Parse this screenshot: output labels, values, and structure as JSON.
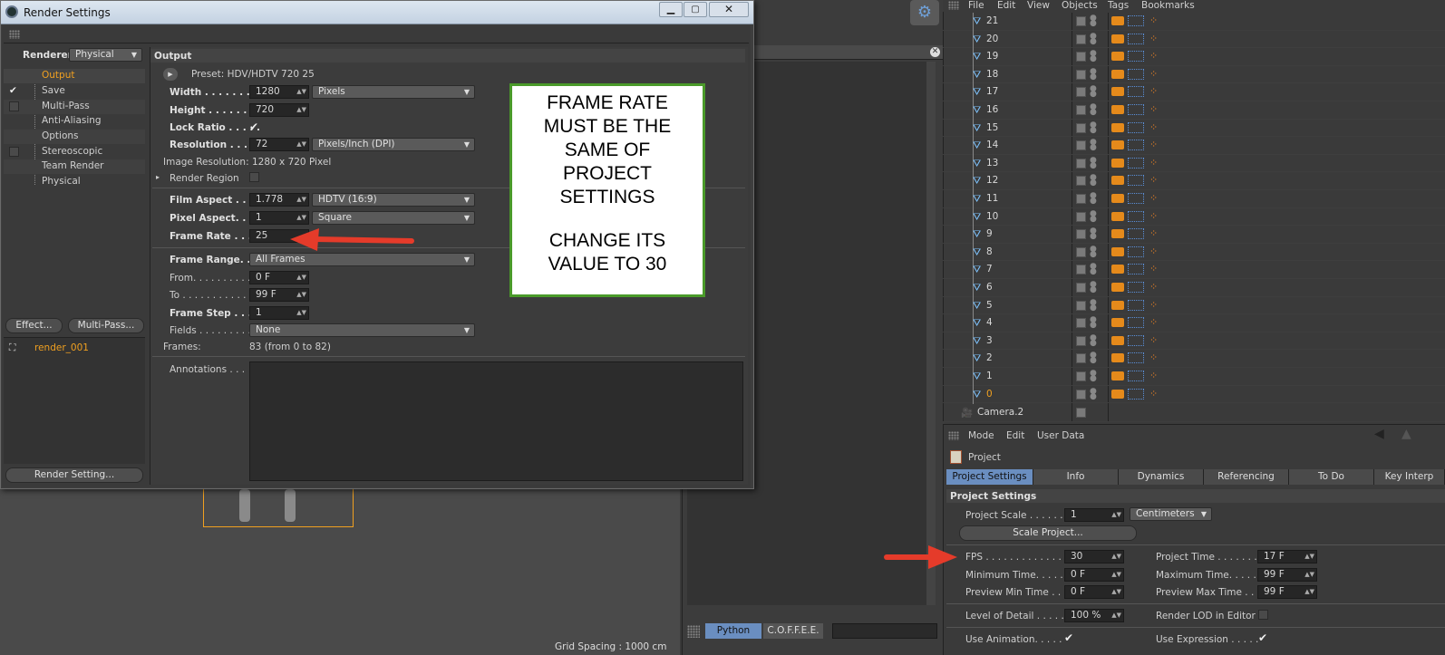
{
  "render_window": {
    "title": "Render Settings",
    "renderer_label": "Renderer",
    "renderer_value": "Physical",
    "nav": [
      {
        "label": "Output",
        "active": true
      },
      {
        "label": "Save",
        "check": "✔"
      },
      {
        "label": "Multi-Pass",
        "check": "box"
      },
      {
        "label": "Anti-Aliasing"
      },
      {
        "label": "Options"
      },
      {
        "label": "Stereoscopic",
        "check": "box"
      },
      {
        "label": "Team Render"
      },
      {
        "label": "Physical"
      }
    ],
    "effect_btn": "Effect...",
    "multipass_btn": "Multi-Pass...",
    "render_item": "render_001",
    "render_setting_btn": "Render Setting..."
  },
  "output": {
    "header": "Output",
    "preset": "Preset: HDV/HDTV 720 25",
    "width_label": "Width . . . . . . . . .",
    "width": "1280",
    "width_unit": "Pixels",
    "height_label": "Height . . . . . . . . .",
    "height": "720",
    "lock_label": "Lock Ratio . . . . .",
    "lock_check": "✔",
    "res_label": "Resolution . . . . .",
    "res": "72",
    "res_unit": "Pixels/Inch (DPI)",
    "image_res": "Image Resolution: 1280 x 720 Pixel",
    "render_region": "Render Region",
    "film_aspect_label": "Film Aspect . . . .",
    "film_aspect": "1.778",
    "film_aspect_unit": "HDTV (16:9)",
    "pixel_aspect_label": "Pixel Aspect. . . .",
    "pixel_aspect": "1",
    "pixel_aspect_unit": "Square",
    "frame_rate_label": "Frame Rate . . . .",
    "frame_rate": "25",
    "frame_range_label": "Frame Range. . .",
    "frame_range": "All Frames",
    "from_label": "From. . . . . . . . . .",
    "from": "0 F",
    "to_label": "To . . . . . . . . . . . .",
    "to": "99 F",
    "step_label": "Frame Step . . . .",
    "step": "1",
    "fields_label": "Fields . . . . . . . . .",
    "fields": "None",
    "frames_label": "Frames:",
    "frames": "83 (from 0 to 82)",
    "annotations_label": "Annotations . . ."
  },
  "callout": {
    "line1": "FRAME RATE",
    "line2": "MUST BE THE",
    "line3": "SAME OF",
    "line4": "PROJECT",
    "line5": "SETTINGS",
    "line6": "CHANGE ITS",
    "line7": "VALUE TO 30"
  },
  "object_manager": {
    "menu": [
      "File",
      "Edit",
      "View",
      "Objects",
      "Tags",
      "Bookmarks"
    ],
    "rows": [
      "21",
      "20",
      "19",
      "18",
      "17",
      "16",
      "15",
      "14",
      "13",
      "12",
      "11",
      "10",
      "9",
      "8",
      "7",
      "6",
      "5",
      "4",
      "3",
      "2",
      "1",
      "0"
    ],
    "camera": "Camera.2"
  },
  "attributes": {
    "menu": [
      "Mode",
      "Edit",
      "User Data"
    ],
    "object": "Project",
    "tabs": [
      "Project Settings",
      "Info",
      "Dynamics",
      "Referencing",
      "To Do",
      "Key Interp"
    ],
    "section": "Project Settings",
    "scale_label": "Project Scale . . . . . .",
    "scale": "1",
    "scale_unit": "Centimeters",
    "scale_btn": "Scale Project...",
    "fps_label": "FPS . . . . . . . . . . . . . .",
    "fps": "30",
    "ptime_label": "Project Time . . . . . . . .",
    "ptime": "17 F",
    "min_label": "Minimum Time. . . . .",
    "min": "0 F",
    "max_label": "Maximum Time. . . . . .",
    "max": "99 F",
    "pmin_label": "Preview Min Time . . .",
    "pmin": "0 F",
    "pmax_label": "Preview Max Time . . .",
    "pmax": "99 F",
    "lod_label": "Level of Detail . . . . .",
    "lod": "100 %",
    "lod_render": "Render LOD in Editor",
    "anim_label": "Use Animation. . . . .",
    "expr_label": "Use Expression . . . . ."
  },
  "console": {
    "tab1": "Python",
    "tab2": "C.O.F.F.E.E."
  },
  "viewport": {
    "grid": "Grid Spacing : 1000 cm"
  }
}
